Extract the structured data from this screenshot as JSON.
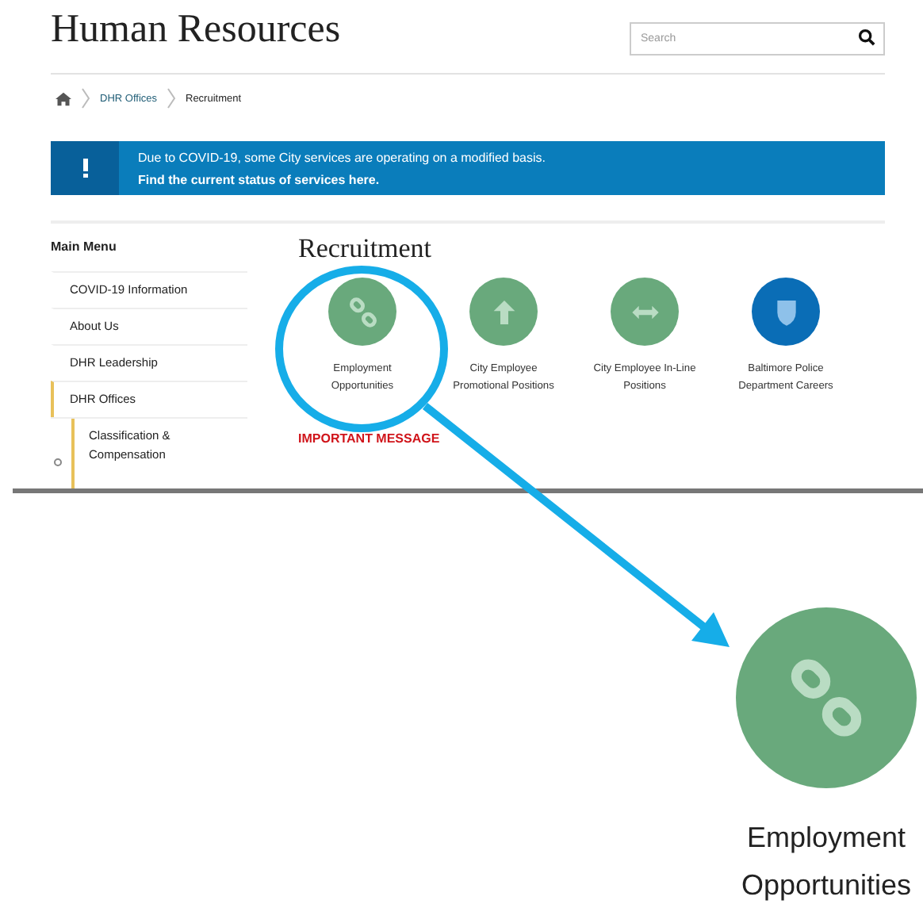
{
  "header": {
    "title": "Human Resources",
    "search": {
      "placeholder": "Search"
    }
  },
  "breadcrumb": [
    {
      "label": "DHR Offices",
      "kind": "link"
    },
    {
      "label": "Recruitment",
      "kind": "current"
    }
  ],
  "alert": {
    "line": "Due to COVID-19, some City services are operating on a modified basis.",
    "link": "Find the current status of services here."
  },
  "sidebar": {
    "title": "Main Menu",
    "items": [
      {
        "label": "COVID-19 Information",
        "selected": false
      },
      {
        "label": "About Us",
        "selected": false
      },
      {
        "label": "DHR Leadership",
        "selected": false
      },
      {
        "label": "DHR Offices",
        "selected": true,
        "children": [
          {
            "label": "Classification & Compensation"
          }
        ]
      }
    ]
  },
  "main": {
    "title": "Recruitment",
    "tiles": [
      {
        "lines": [
          "Employment",
          "Opportunities"
        ],
        "kind": "link",
        "color": "#69a97c"
      },
      {
        "lines": [
          "City Employee",
          "Promotional Positions"
        ],
        "kind": "arrow-up",
        "color": "#69a97c"
      },
      {
        "lines": [
          "City Employee In-Line",
          "Positions"
        ],
        "kind": "arrows-horizontal",
        "color": "#69a97c"
      },
      {
        "lines": [
          "Baltimore Police",
          "Department Careers"
        ],
        "kind": "shield",
        "color": "#0a6db6"
      }
    ],
    "important": "IMPORTANT MESSAGE"
  },
  "callout": {
    "tile": {
      "lines": [
        "Employment",
        "Opportunities"
      ],
      "kind": "link",
      "color": "#69a97c"
    }
  }
}
